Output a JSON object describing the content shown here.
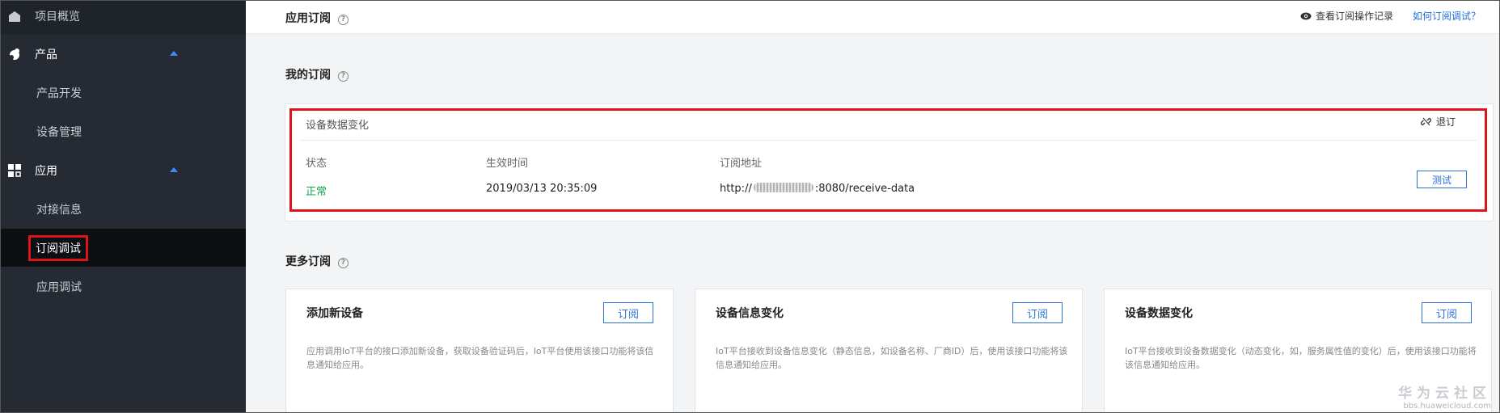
{
  "sidebar": {
    "items": [
      {
        "label": "项目概览",
        "icon": "home-icon"
      },
      {
        "label": "产品",
        "icon": "product-icon"
      },
      {
        "label": "产品开发"
      },
      {
        "label": "设备管理"
      },
      {
        "label": "应用",
        "icon": "grid-icon"
      },
      {
        "label": "对接信息"
      },
      {
        "label": "订阅调试"
      },
      {
        "label": "应用调试"
      }
    ]
  },
  "header": {
    "title": "应用订阅",
    "help_mark": "?",
    "view_record": "查看订阅操作记录",
    "how_to": "如何订阅调试？"
  },
  "my_subscription": {
    "title": "我的订阅",
    "help_mark": "?",
    "item": {
      "name": "设备数据变化",
      "unsubscribe": "退订",
      "col_status": "状态",
      "col_time": "生效时间",
      "col_url": "订阅地址",
      "status": "正常",
      "time": "2019/03/13 20:35:09",
      "url_prefix": "http://",
      "url_suffix": ":8080/receive-data",
      "test_button": "测试"
    }
  },
  "more_subscription": {
    "title": "更多订阅",
    "help_mark": "?",
    "cards": [
      {
        "title": "添加新设备",
        "button": "订阅",
        "desc": "应用调用IoT平台的接口添加新设备，获取设备验证码后，IoT平台使用该接口功能将该信息通知给应用。"
      },
      {
        "title": "设备信息变化",
        "button": "订阅",
        "desc": "IoT平台接收到设备信息变化（静态信息，如设备名称、厂商ID）后，使用该接口功能将该信息通知给应用。"
      },
      {
        "title": "设备数据变化",
        "button": "订阅",
        "desc": "IoT平台接收到设备数据变化（动态变化，如，服务属性值的变化）后，使用该接口功能将该信息通知给应用。"
      }
    ]
  },
  "watermark": {
    "brand": "华为云社区",
    "site": "bbs.huaweicloud.com"
  },
  "colors": {
    "sidebar_bg": "#262b33",
    "accent_blue": "#2a70d6",
    "status_green": "#13a64a",
    "highlight_red": "#d9161c"
  }
}
